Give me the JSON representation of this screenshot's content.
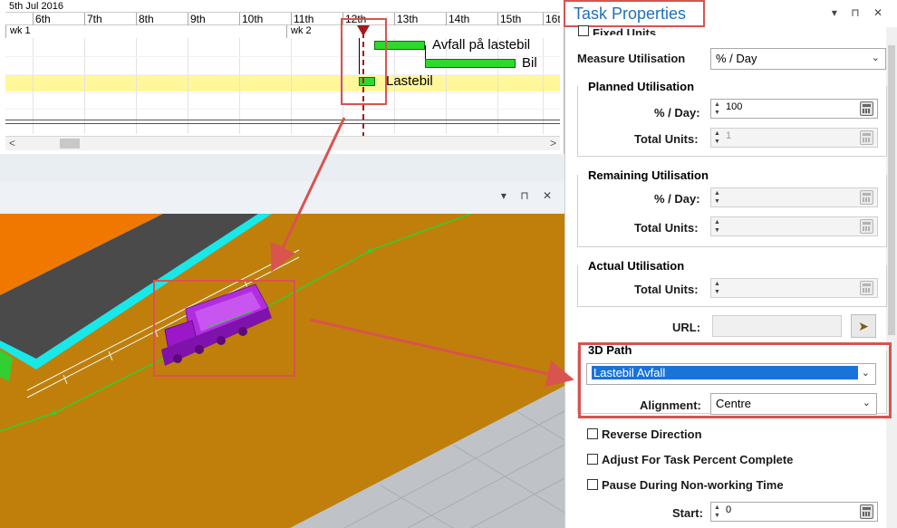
{
  "gantt": {
    "date_header": "5th Jul 2016",
    "days": [
      "6th",
      "7th",
      "8th",
      "9th",
      "10th",
      "11th",
      "12th",
      "13th",
      "14th",
      "15th",
      "16t"
    ],
    "weeks": [
      "wk 1",
      "wk 2"
    ],
    "tasks": [
      {
        "label": "Avfall på lastebil",
        "color": "#2ed92e"
      },
      {
        "label": "Bil",
        "color": "#2ed92e"
      },
      {
        "label": "Lastebil",
        "color": "#2ed92e"
      }
    ],
    "scroll_left": "<",
    "scroll_right": ">"
  },
  "pane3d": {
    "buttons": "▾ ⊓ ✕",
    "colors": {
      "ground": "#c07f0a",
      "wall": "#18e8e8",
      "floor": "#4a4a4a",
      "roof": "#f07800",
      "truck": "#a020d0",
      "path": "#2fd02f",
      "gray": "#bfc3c8"
    }
  },
  "props": {
    "title": "Task Properties",
    "header_buttons": "▾ ⊓ ✕",
    "fixed_units_label": "Fixed Units",
    "measure_label": "Measure Utilisation",
    "measure_value": "% / Day",
    "planned": {
      "title": "Planned Utilisation",
      "per_day_label": "% / Day:",
      "per_day_value": "100",
      "total_label": "Total Units:",
      "total_value": "1"
    },
    "remaining": {
      "title": "Remaining Utilisation",
      "per_day_label": "% / Day:",
      "total_label": "Total Units:"
    },
    "actual": {
      "title": "Actual Utilisation",
      "total_label": "Total Units:"
    },
    "url_label": "URL:",
    "path3d": {
      "title": "3D Path",
      "value": "Lastebil Avfall",
      "alignment_label": "Alignment:",
      "alignment_value": "Centre"
    },
    "checkboxes": [
      "Reverse Direction",
      "Adjust For Task Percent Complete",
      "Pause During Non-working Time"
    ],
    "start_label": "Start:",
    "start_value": "0"
  },
  "accent": "#d9534f"
}
